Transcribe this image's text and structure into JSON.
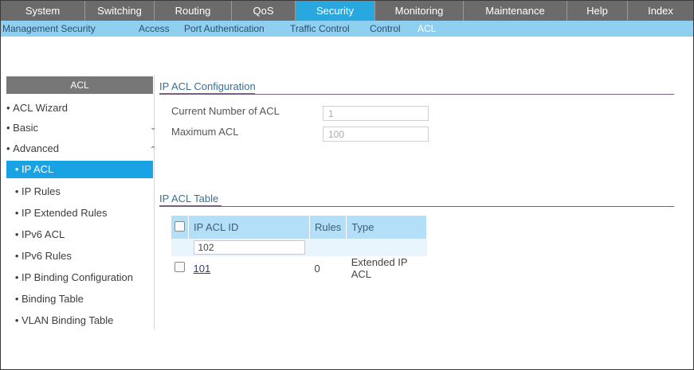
{
  "topnav": [
    {
      "label": "System"
    },
    {
      "label": "Switching"
    },
    {
      "label": "Routing"
    },
    {
      "label": "QoS"
    },
    {
      "label": "Security"
    },
    {
      "label": "Monitoring"
    },
    {
      "label": "Maintenance"
    },
    {
      "label": "Help"
    },
    {
      "label": "Index"
    }
  ],
  "subnav": [
    {
      "label": "Management Security"
    },
    {
      "label": "Access"
    },
    {
      "label": "Port Authentication"
    },
    {
      "label": "Traffic Control"
    },
    {
      "label": "Control"
    },
    {
      "label": "ACL"
    }
  ],
  "sidebar": {
    "header": "ACL",
    "items": [
      {
        "label": "ACL Wizard"
      },
      {
        "label": "Basic"
      },
      {
        "label": "Advanced"
      },
      {
        "label": "IP ACL"
      },
      {
        "label": "IP Rules"
      },
      {
        "label": "IP Extended Rules"
      },
      {
        "label": "IPv6 ACL"
      },
      {
        "label": "IPv6 Rules"
      },
      {
        "label": "IP Binding Configuration"
      },
      {
        "label": "Binding Table"
      },
      {
        "label": "VLAN Binding Table"
      }
    ]
  },
  "config": {
    "title": "IP ACL Configuration",
    "current_label": "Current Number of ACL",
    "current_value": "1",
    "max_label": "Maximum ACL",
    "max_value": "100"
  },
  "table": {
    "title": "IP ACL Table",
    "headers": {
      "id": "IP ACL ID",
      "rules": "Rules",
      "type": "Type"
    },
    "new_id_value": "102",
    "rows": [
      {
        "id": "101",
        "rules": "0",
        "type": "Extended IP ACL"
      }
    ]
  },
  "colors": {
    "topnav_bg": "#6b6b6b",
    "active_tab": "#29a8e0",
    "subnav_bg": "#8fcff0",
    "sidebar_active": "#1aa3e4",
    "table_header": "#b3e0f8"
  }
}
